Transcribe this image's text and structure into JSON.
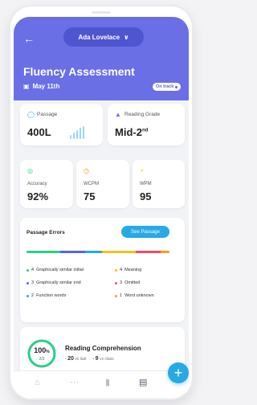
{
  "header": {
    "back_icon": "arrow-left-icon",
    "user_name": "Ada Lovelace",
    "title": "Fluency Assessment",
    "date": "May 11th",
    "status": "On track",
    "color": "#6a6fe6"
  },
  "metrics": {
    "passage": {
      "label": "Passage",
      "value": "400L",
      "icon": "bulb-icon"
    },
    "reading_grade": {
      "label": "Reading Grade",
      "value": "Mid-2",
      "suffix": "nd",
      "icon": "graduation-cap-icon"
    },
    "accuracy": {
      "label": "Accuracy",
      "value": "92%",
      "icon": "target-icon"
    },
    "wcpm": {
      "label": "WCPM",
      "value": "75",
      "icon": "timer-icon"
    },
    "wpm": {
      "label": "WPM",
      "value": "95",
      "icon": "lightning-icon"
    }
  },
  "passage_errors": {
    "title": "Passage Errors",
    "button": "See Passage",
    "legend": [
      {
        "count": "4",
        "label": "Graphically similar initial",
        "color": "#2ecc8a"
      },
      {
        "count": "4",
        "label": "Meaning",
        "color": "#f2c218"
      },
      {
        "count": "3",
        "label": "Graphically similar end",
        "color": "#5a63e0"
      },
      {
        "count": "3",
        "label": "Omitted",
        "color": "#ef4d6a"
      },
      {
        "count": "2",
        "label": "Function words",
        "color": "#27a9e4"
      },
      {
        "count": "1",
        "label": "Word unknown",
        "color": "#f59a2a"
      }
    ]
  },
  "comprehension": {
    "percent": "100",
    "score": "2/3",
    "title": "Reading Comprehension",
    "vs_last_value": "20",
    "vs_last_label": "vs last",
    "vs_class_value": "9",
    "vs_class_label": "vs class",
    "color": "#2ecc8a"
  },
  "tabs": [
    {
      "icon": "home-icon"
    },
    {
      "icon": "group-icon"
    },
    {
      "icon": "bar-chart-icon"
    },
    {
      "icon": "document-icon",
      "active": true
    }
  ],
  "fab": {
    "icon": "plus-icon"
  }
}
